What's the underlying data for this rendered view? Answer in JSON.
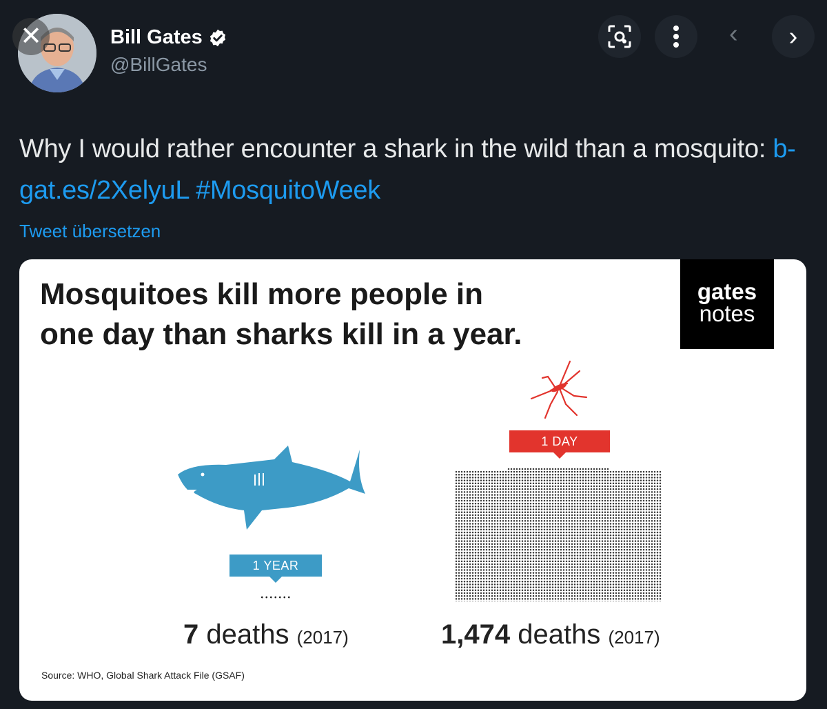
{
  "header": {
    "close_glyph": "✕",
    "name": "Bill Gates",
    "handle": "@BillGates",
    "verified": true,
    "icons": [
      "close-icon",
      "lens-icon",
      "more-icon",
      "chevron-left-icon",
      "chevron-right-icon"
    ]
  },
  "tweet": {
    "text_pre": "Why I would rather encounter a shark in the wild than a mosquito: ",
    "link": "b-gat.es/2XelyuL",
    "hashtag": "#MosquitoWeek",
    "translate": "Tweet übersetzen"
  },
  "card": {
    "headline_line1": "Mosquitoes kill more people in",
    "headline_line2": "one day than sharks kill in a year.",
    "brand_line1": "gates",
    "brand_line2": "notes",
    "shark_tag": "1 YEAR",
    "mosquito_tag": "1 DAY",
    "shark_deaths_number": "7",
    "shark_deaths_word": "deaths",
    "shark_deaths_year": "(2017)",
    "mosquito_deaths_number": "1,474",
    "mosquito_deaths_word": "deaths",
    "mosquito_deaths_year": "(2017)",
    "source": "Source: WHO, Global Shark Attack File (GSAF)"
  },
  "colors": {
    "background": "#161b22",
    "link": "#1d9bf0",
    "shark": "#3d9bc6",
    "mosquito": "#e2342d"
  }
}
